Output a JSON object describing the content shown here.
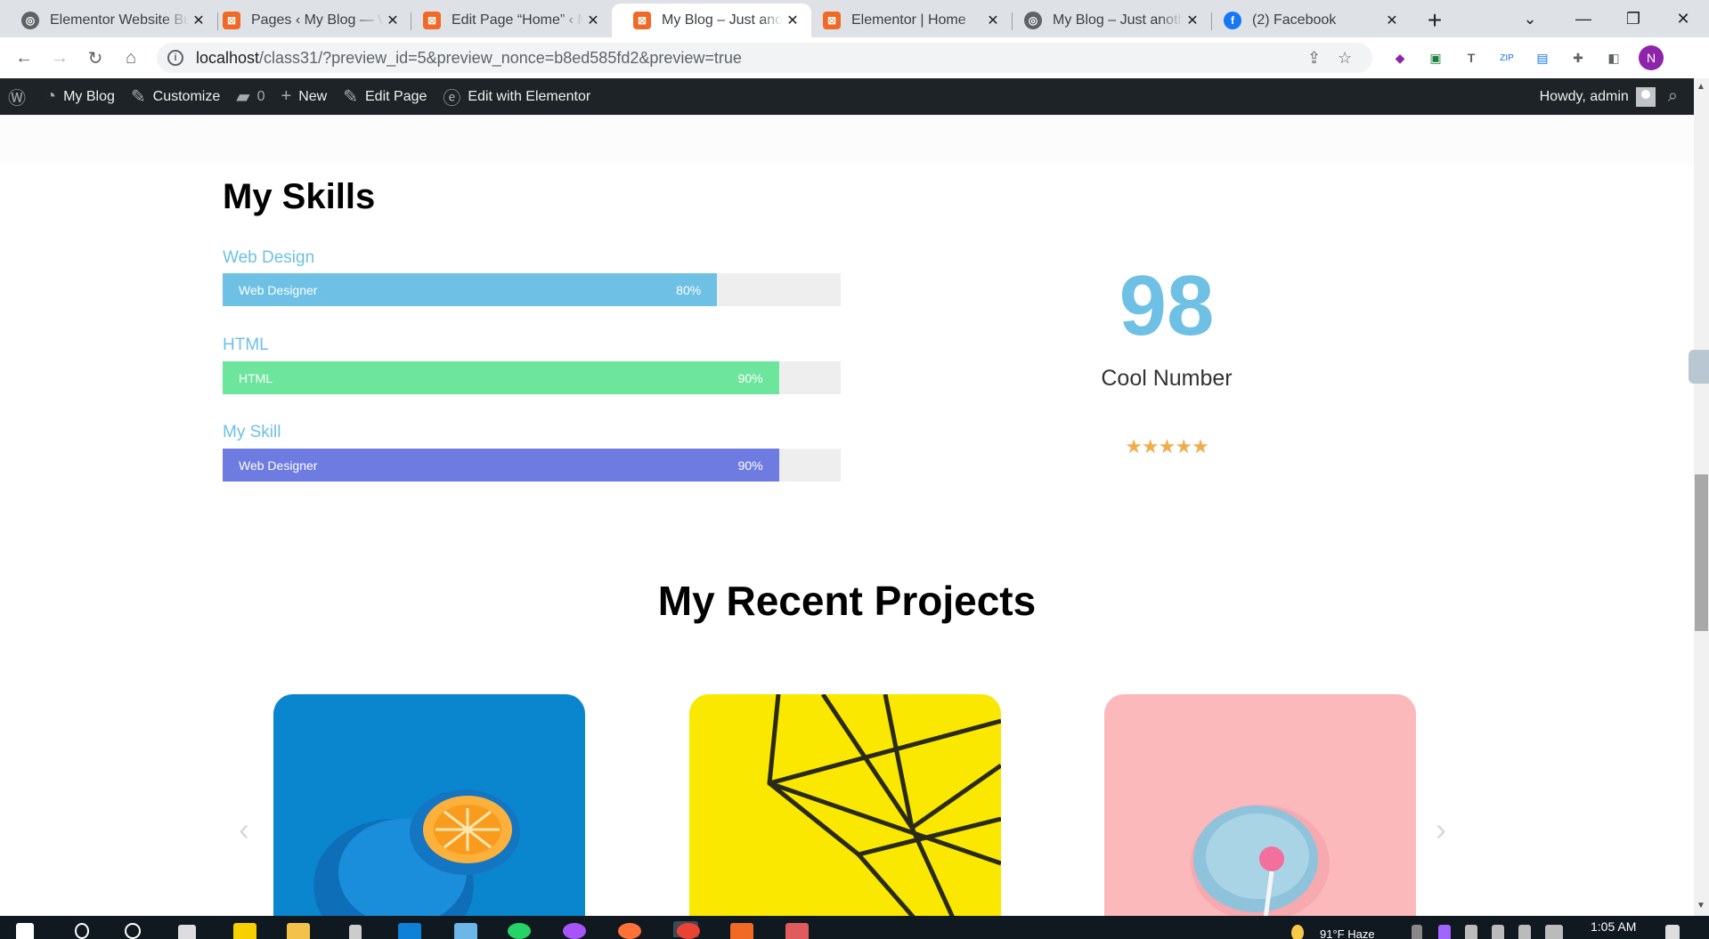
{
  "browser": {
    "tabs": [
      {
        "title": "Elementor Website Bu",
        "favicon": "wp-globe-icon",
        "active": false
      },
      {
        "title": "Pages ‹ My Blog — W",
        "favicon": "xampp-icon",
        "active": false
      },
      {
        "title": "Edit Page “Home” ‹ M",
        "favicon": "xampp-icon",
        "active": false
      },
      {
        "title": "My Blog – Just anothe",
        "favicon": "xampp-icon",
        "active": true
      },
      {
        "title": "Elementor | Home",
        "favicon": "xampp-icon",
        "active": false
      },
      {
        "title": "My Blog – Just anothe",
        "favicon": "wp-globe-icon",
        "active": false
      },
      {
        "title": "(2) Facebook",
        "favicon": "facebook-icon",
        "active": false
      }
    ],
    "url_host": "localhost",
    "url_path": "/class31/?preview_id=5&preview_nonce=b8ed585fd2&preview=true",
    "profile_initial": "N"
  },
  "adminbar": {
    "site_name": "My Blog",
    "customize": "Customize",
    "comments_count": "0",
    "new": "New",
    "edit_page": "Edit Page",
    "edit_elementor": "Edit with Elementor",
    "howdy": "Howdy, admin"
  },
  "skills": {
    "heading": "My Skills",
    "items": [
      {
        "title": "Web Design",
        "bar_label": "Web Designer",
        "percent_text": "80%",
        "percent": 80,
        "color": "#6ec1e4"
      },
      {
        "title": "HTML",
        "bar_label": "HTML",
        "percent_text": "90%",
        "percent": 90,
        "color": "#6ee59c"
      },
      {
        "title": "My Skill",
        "bar_label": "Web Designer",
        "percent_text": "90%",
        "percent": 90,
        "color": "#6e7be1"
      }
    ]
  },
  "counter": {
    "number": "98",
    "label": "Cool Number",
    "rating": 5,
    "stars": "★★★★★"
  },
  "projects": {
    "heading": "My Recent Projects",
    "prev_arrow": "‹",
    "next_arrow": "›"
  },
  "taskbar": {
    "time": "1:05 AM",
    "weather": "91°F  Haze"
  }
}
